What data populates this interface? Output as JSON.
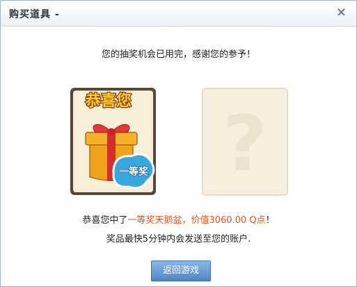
{
  "dialog": {
    "title": "购买道具 -",
    "close_glyph": "×"
  },
  "message_top": "您的抽奖机会已用完，感谢您的参予！",
  "card_left": {
    "banner": "恭喜您",
    "badge": "一等奖"
  },
  "card_right": {
    "glyph": "?"
  },
  "result": {
    "prefix": "恭喜您中了",
    "tier": "一等奖",
    "prize": "天鹅盆，价值3060.00 Q点",
    "suffix": "！"
  },
  "delivery_note": "奖品最快5分钟内会发送至您的账户.",
  "return_button": "返回游戏",
  "colors": {
    "accent_orange": "#e8531b",
    "button_blue": "#4d86c6",
    "card_border": "#5a4633",
    "card_bg": "#f7efd9"
  }
}
